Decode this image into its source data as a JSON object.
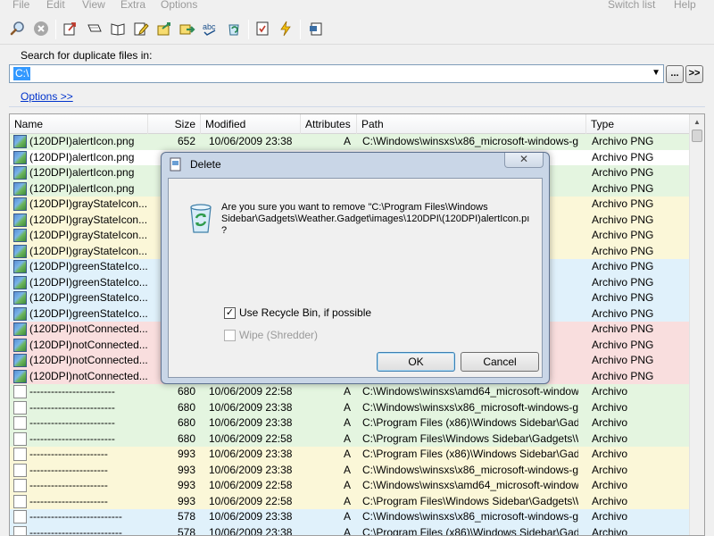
{
  "menu": {
    "left": [
      "File",
      "Edit",
      "View",
      "Extra",
      "Options"
    ],
    "right": [
      "Switch list",
      "Help"
    ]
  },
  "toolbar": {
    "icons": [
      "search-icon",
      "stop-icon",
      "open-external-icon",
      "rename-icon",
      "open-book-icon",
      "edit-icon",
      "move-icon",
      "forward-icon",
      "spell-icon",
      "recycle-icon",
      "checklist-icon",
      "lightning-icon",
      "export-icon"
    ]
  },
  "search": {
    "label": "Search for duplicate files in:",
    "path_value": "C:\\",
    "browse_label": "...",
    "more_label": ">>"
  },
  "options_link": "Options  >>",
  "grid": {
    "columns": [
      "Name",
      "Size",
      "Modified",
      "Attributes",
      "Path",
      "Type"
    ],
    "row_colors": {
      "green": "#e4f5e0",
      "yellow": "#fbf7d8",
      "blue": "#e0f1fb",
      "red": "#f9dede",
      "selected": "#ffffff"
    },
    "rows": [
      {
        "icon": "png",
        "color": "green",
        "name": "(120DPI)alertIcon.png",
        "size": "652",
        "modified": "10/06/2009  23:38",
        "attr": "A",
        "path": "C:\\Windows\\winsxs\\x86_microsoft-windows-g...",
        "type": "Archivo PNG"
      },
      {
        "icon": "png",
        "color": "selected",
        "name": "(120DPI)alertIcon.png",
        "size": "",
        "modified": "",
        "attr": "",
        "path": "",
        "type": "Archivo PNG"
      },
      {
        "icon": "png",
        "color": "green",
        "name": "(120DPI)alertIcon.png",
        "size": "",
        "modified": "",
        "attr": "",
        "path": "",
        "type": "Archivo PNG"
      },
      {
        "icon": "png",
        "color": "green",
        "name": "(120DPI)alertIcon.png",
        "size": "",
        "modified": "",
        "attr": "",
        "path": "",
        "type": "Archivo PNG"
      },
      {
        "icon": "png",
        "color": "yellow",
        "name": "(120DPI)grayStateIcon...",
        "size": "",
        "modified": "",
        "attr": "",
        "path": "",
        "type": "Archivo PNG"
      },
      {
        "icon": "png",
        "color": "yellow",
        "name": "(120DPI)grayStateIcon...",
        "size": "",
        "modified": "",
        "attr": "",
        "path": "",
        "type": "Archivo PNG"
      },
      {
        "icon": "png",
        "color": "yellow",
        "name": "(120DPI)grayStateIcon...",
        "size": "",
        "modified": "",
        "attr": "",
        "path": "",
        "type": "Archivo PNG"
      },
      {
        "icon": "png",
        "color": "yellow",
        "name": "(120DPI)grayStateIcon...",
        "size": "",
        "modified": "",
        "attr": "",
        "path": "",
        "type": "Archivo PNG"
      },
      {
        "icon": "png",
        "color": "blue",
        "name": "(120DPI)greenStateIco...",
        "size": "",
        "modified": "",
        "attr": "",
        "path": "",
        "type": "Archivo PNG"
      },
      {
        "icon": "png",
        "color": "blue",
        "name": "(120DPI)greenStateIco...",
        "size": "",
        "modified": "",
        "attr": "",
        "path": "",
        "type": "Archivo PNG"
      },
      {
        "icon": "png",
        "color": "blue",
        "name": "(120DPI)greenStateIco...",
        "size": "",
        "modified": "",
        "attr": "",
        "path": "",
        "type": "Archivo PNG"
      },
      {
        "icon": "png",
        "color": "blue",
        "name": "(120DPI)greenStateIco...",
        "size": "",
        "modified": "",
        "attr": "",
        "path": "",
        "type": "Archivo PNG"
      },
      {
        "icon": "png",
        "color": "red",
        "name": "(120DPI)notConnected...",
        "size": "",
        "modified": "",
        "attr": "",
        "path": "",
        "type": "Archivo PNG"
      },
      {
        "icon": "png",
        "color": "red",
        "name": "(120DPI)notConnected...",
        "size": "",
        "modified": "",
        "attr": "",
        "path": "",
        "type": "Archivo PNG"
      },
      {
        "icon": "png",
        "color": "red",
        "name": "(120DPI)notConnected...",
        "size": "",
        "modified": "",
        "attr": "",
        "path": "",
        "type": "Archivo PNG"
      },
      {
        "icon": "png",
        "color": "red",
        "name": "(120DPI)notConnected...",
        "size": "",
        "modified": "",
        "attr": "",
        "path": "",
        "type": "Archivo PNG"
      },
      {
        "icon": "doc",
        "color": "green",
        "name": "------------------------",
        "size": "680",
        "modified": "10/06/2009  22:58",
        "attr": "A",
        "path": "C:\\Windows\\winsxs\\amd64_microsoft-windows...",
        "type": "Archivo"
      },
      {
        "icon": "doc",
        "color": "green",
        "name": "------------------------",
        "size": "680",
        "modified": "10/06/2009  23:38",
        "attr": "A",
        "path": "C:\\Windows\\winsxs\\x86_microsoft-windows-g...",
        "type": "Archivo"
      },
      {
        "icon": "doc",
        "color": "green",
        "name": "------------------------",
        "size": "680",
        "modified": "10/06/2009  23:38",
        "attr": "A",
        "path": "C:\\Program Files (x86)\\Windows Sidebar\\Gadg...",
        "type": "Archivo"
      },
      {
        "icon": "doc",
        "color": "green",
        "name": "------------------------",
        "size": "680",
        "modified": "10/06/2009  22:58",
        "attr": "A",
        "path": "C:\\Program Files\\Windows Sidebar\\Gadgets\\W...",
        "type": "Archivo"
      },
      {
        "icon": "doc",
        "color": "yellow",
        "name": "----------------------",
        "size": "993",
        "modified": "10/06/2009  23:38",
        "attr": "A",
        "path": "C:\\Program Files (x86)\\Windows Sidebar\\Gadg...",
        "type": "Archivo"
      },
      {
        "icon": "doc",
        "color": "yellow",
        "name": "----------------------",
        "size": "993",
        "modified": "10/06/2009  23:38",
        "attr": "A",
        "path": "C:\\Windows\\winsxs\\x86_microsoft-windows-g...",
        "type": "Archivo"
      },
      {
        "icon": "doc",
        "color": "yellow",
        "name": "----------------------",
        "size": "993",
        "modified": "10/06/2009  22:58",
        "attr": "A",
        "path": "C:\\Windows\\winsxs\\amd64_microsoft-window...",
        "type": "Archivo"
      },
      {
        "icon": "doc",
        "color": "yellow",
        "name": "----------------------",
        "size": "993",
        "modified": "10/06/2009  22:58",
        "attr": "A",
        "path": "C:\\Program Files\\Windows Sidebar\\Gadgets\\W...",
        "type": "Archivo"
      },
      {
        "icon": "doc",
        "color": "blue",
        "name": "--------------------------",
        "size": "578",
        "modified": "10/06/2009  23:38",
        "attr": "A",
        "path": "C:\\Windows\\winsxs\\x86_microsoft-windows-g...",
        "type": "Archivo"
      },
      {
        "icon": "doc",
        "color": "blue",
        "name": "--------------------------",
        "size": "578",
        "modified": "10/06/2009  23:38",
        "attr": "A",
        "path": "C:\\Program Files (x86)\\Windows Sidebar\\Gadg...",
        "type": "Archivo"
      }
    ]
  },
  "dialog": {
    "title": "Delete",
    "close_glyph": "✕",
    "message": "Are you sure you want to remove \"C:\\Program Files\\Windows\nSidebar\\Gadgets\\Weather.Gadget\\images\\120DPI\\(120DPI)alertIcon.pı\n?",
    "use_recycle_label": "Use Recycle Bin, if possible",
    "use_recycle_checked": true,
    "wipe_label": "Wipe (Shredder)",
    "wipe_checked": false,
    "ok_label": "OK",
    "cancel_label": "Cancel"
  }
}
